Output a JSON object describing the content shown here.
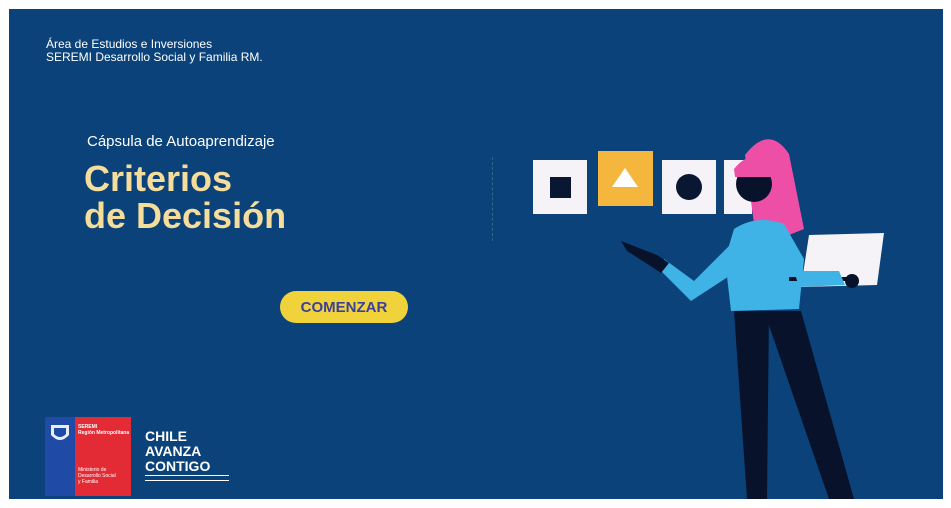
{
  "header": {
    "org_line1": "Área de Estudios e Inversiones",
    "org_line2": "SEREMI Desarrollo Social y Familia RM."
  },
  "hero": {
    "subtitle": "Cápsula de Autoaprendizaje",
    "title_line1": "Criterios",
    "title_line2": "de Decisión",
    "start_button": "COMENZAR"
  },
  "footer": {
    "seremi_logo": {
      "top_line1": "SEREMI",
      "top_line2": "Región Metropolitana",
      "bottom_line1": "Ministerio de",
      "bottom_line2": "Desarrollo Social",
      "bottom_line3": "y Familia"
    },
    "slogan_line1": "CHILE",
    "slogan_line2": "AVANZA",
    "slogan_line3": "CONTIGO"
  },
  "colors": {
    "background": "#0b4279",
    "title": "#f5dd9b",
    "button": "#f0d33b",
    "button_text": "#3b3f9e",
    "hair": "#ee4fa6",
    "shirt": "#3fb3e6"
  },
  "icons": [
    "square-tile-icon",
    "triangle-tile-icon",
    "circle-tile-icon"
  ]
}
